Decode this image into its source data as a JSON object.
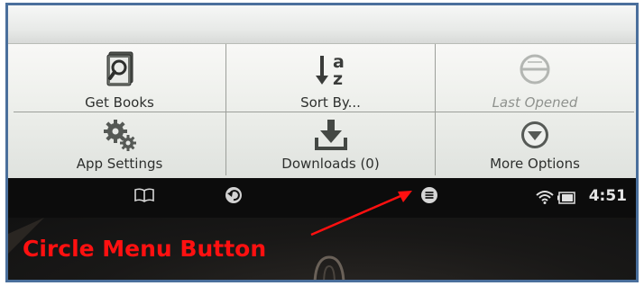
{
  "menu": {
    "items": [
      {
        "label": "Get Books",
        "icon": "book-search-icon",
        "enabled": true
      },
      {
        "label": "Sort By...",
        "icon": "sort-az-icon",
        "enabled": true
      },
      {
        "label": "Last Opened",
        "icon": "last-opened-icon",
        "enabled": false
      },
      {
        "label": "App Settings",
        "icon": "gears-icon",
        "enabled": true
      },
      {
        "label": "Downloads (0)",
        "icon": "download-icon",
        "enabled": true
      },
      {
        "label": "More Options",
        "icon": "chevron-circle-icon",
        "enabled": true
      }
    ]
  },
  "status_bar": {
    "time": "4:51",
    "buttons": [
      "book-icon",
      "back-icon",
      "menu-icon"
    ],
    "indicators": [
      "wifi-icon",
      "battery-icon"
    ]
  },
  "annotation": {
    "text": "Circle Menu Button",
    "color": "#ff1010"
  },
  "colors": {
    "frame_border": "#4a6f9c",
    "panel": "#eceeea",
    "status_bar": "#0c0c0c"
  }
}
